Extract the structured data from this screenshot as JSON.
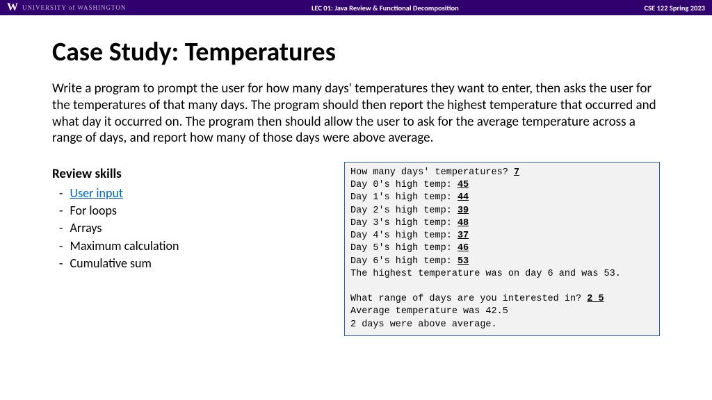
{
  "header": {
    "logo_letter": "W",
    "university_text": "UNIVERSITY of WASHINGTON",
    "lecture": "LEC 01: Java Review & Functional Decomposition",
    "course": "CSE 122 Spring 2023"
  },
  "title": "Case Study: Temperatures",
  "description": "Write a program to prompt the user for how many days' temperatures they want to enter, then asks the user for the temperatures of that many days. The program should then report the highest temperature that occurred and what day it occurred on. The program then should allow the user to ask for the average temperature across a range of days, and report how many of those days were above average.",
  "review": {
    "heading": "Review skills",
    "items": [
      {
        "label": "User input",
        "link": true
      },
      {
        "label": "For loops",
        "link": false
      },
      {
        "label": "Arrays",
        "link": false
      },
      {
        "label": "Maximum calculation",
        "link": false
      },
      {
        "label": "Cumulative sum",
        "link": false
      }
    ]
  },
  "console": {
    "lines": [
      {
        "text": "How many days' temperatures? ",
        "input": "7"
      },
      {
        "text": "Day 0's high temp: ",
        "input": "45"
      },
      {
        "text": "Day 1's high temp: ",
        "input": "44"
      },
      {
        "text": "Day 2's high temp: ",
        "input": "39"
      },
      {
        "text": "Day 3's high temp: ",
        "input": "48"
      },
      {
        "text": "Day 4's high temp: ",
        "input": "37"
      },
      {
        "text": "Day 5's high temp: ",
        "input": "46"
      },
      {
        "text": "Day 6's high temp: ",
        "input": "53"
      },
      {
        "text": "The highest temperature was on day 6 and was 53."
      },
      {
        "text": ""
      },
      {
        "text": "What range of days are you interested in? ",
        "input": "2 5"
      },
      {
        "text": "Average temperature was 42.5"
      },
      {
        "text": "2 days were above average."
      }
    ]
  }
}
